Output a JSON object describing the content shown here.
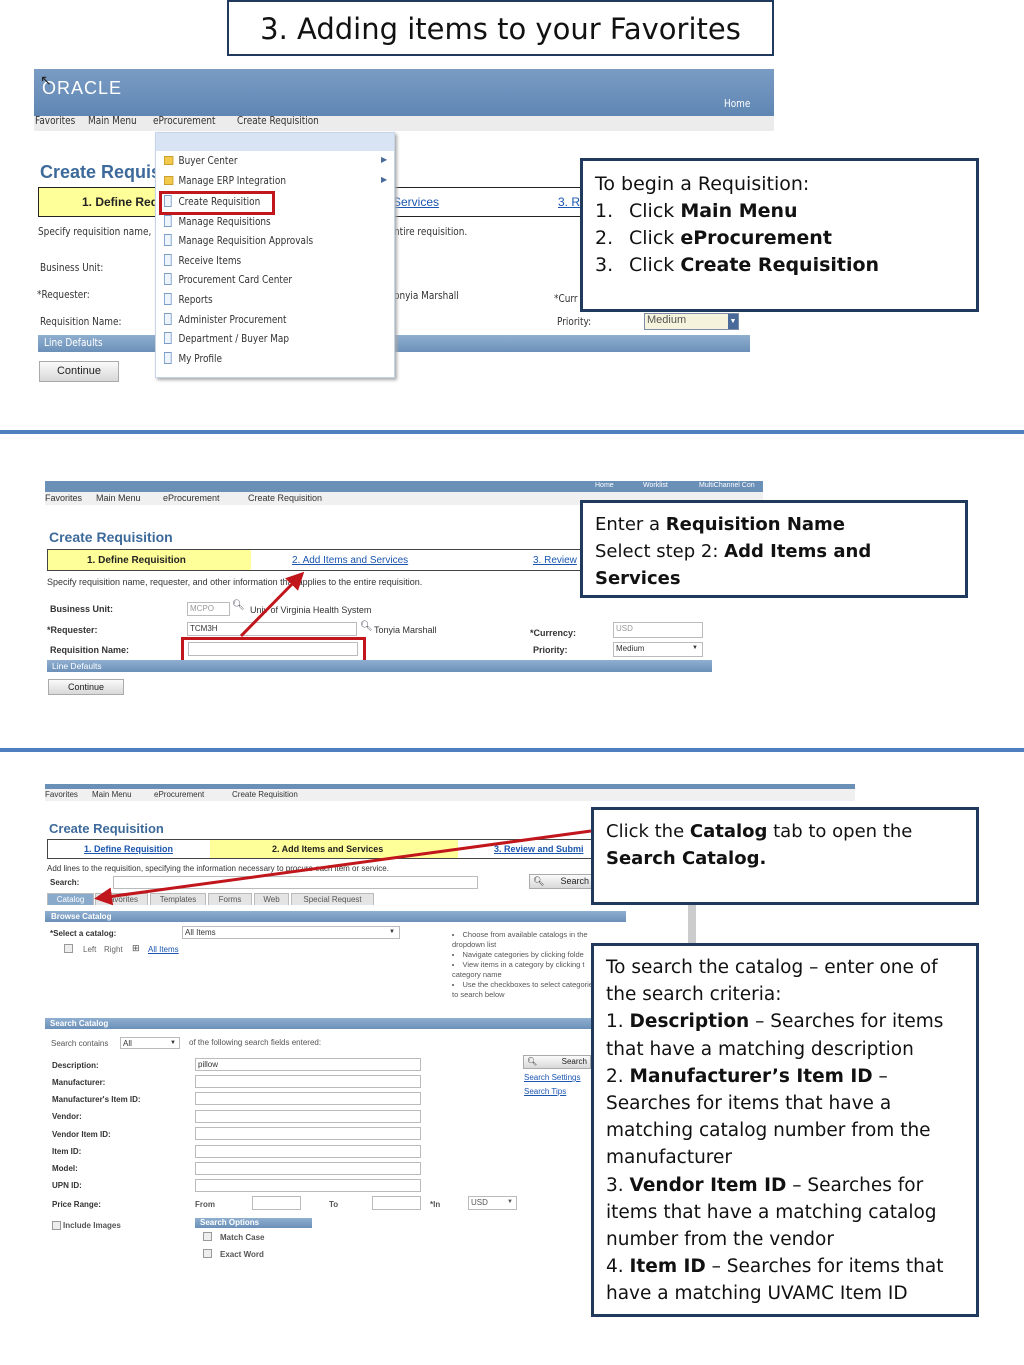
{
  "title": "3. Adding items to your Favorites",
  "colors": {
    "header_blue": "#6b90b8",
    "divider": "#4f7fbf",
    "callout_border": "#1f3a5c",
    "highlight_red": "#c0161c",
    "step_yellow": "#ffff99"
  },
  "panel1": {
    "logo": "ORACLE",
    "home": "Home",
    "breadcrumb": [
      "Favorites",
      "Main Menu",
      "eProcurement",
      "Create Requisition"
    ],
    "page_title": "Create Requisi",
    "step1": "1. Define Req",
    "step2": "Services",
    "step3": "3. R",
    "instruction_left": "Specify requisition name,",
    "instruction_right": "ntire requisition.",
    "labels": {
      "bu": "Business Unit:",
      "req": "*Requester:",
      "name": "Requisition Name:",
      "cur": "*Curr",
      "prio": "Priority:"
    },
    "requester_name": "onyia Marshall",
    "priority": "Medium",
    "line_defaults": "Line Defaults",
    "continue": "Continue",
    "menu": [
      {
        "label": "Buyer Center",
        "icon": "folder-icon",
        "submenu": true
      },
      {
        "label": "Manage ERP Integration",
        "icon": "folder-icon",
        "submenu": true
      },
      {
        "label": "Create Requisition",
        "icon": "document-icon",
        "highlighted": true
      },
      {
        "label": "Manage Requisitions",
        "icon": "document-icon"
      },
      {
        "label": "Manage Requisition Approvals",
        "icon": "document-icon"
      },
      {
        "label": "Receive Items",
        "icon": "document-icon"
      },
      {
        "label": "Procurement Card Center",
        "icon": "document-icon"
      },
      {
        "label": "Reports",
        "icon": "document-icon"
      },
      {
        "label": "Administer Procurement",
        "icon": "document-icon"
      },
      {
        "label": "Department / Buyer Map",
        "icon": "document-icon"
      },
      {
        "label": "My Profile",
        "icon": "document-icon"
      }
    ],
    "callout": {
      "intro": "To begin a Requisition:",
      "steps": [
        {
          "n": "1.",
          "pre": "Click ",
          "bold": "Main Menu"
        },
        {
          "n": "2.",
          "pre": "Click ",
          "bold": "eProcurement"
        },
        {
          "n": "3.",
          "pre": "Click ",
          "bold": "Create Requisition"
        }
      ]
    }
  },
  "panel2": {
    "top_links": [
      "Home",
      "Worklist",
      "MultiChannel Con"
    ],
    "breadcrumb": [
      "Favorites",
      "Main Menu",
      "eProcurement",
      "Create Requisition"
    ],
    "page_title": "Create Requisition",
    "step1": "1. Define Requisition",
    "step2": "2. Add Items and Services",
    "step3": "3. Review",
    "instruction": "Specify requisition name, requester, and other information that applies to the entire requisition.",
    "labels": {
      "bu": "Business Unit:",
      "req": "*Requester:",
      "name": "Requisition Name:",
      "cur": "*Currency:",
      "prio": "Priority:"
    },
    "bu_value": "MCPO",
    "bu_name": "Univ of Virginia Health System",
    "requester": "TCM3H",
    "requester_name": "Tonyia Marshall",
    "currency": "USD",
    "priority": "Medium",
    "requisition_name": "",
    "line_defaults": "Line Defaults",
    "continue": "Continue",
    "callout": {
      "l1_pre": "Enter a ",
      "l1_bold": "Requisition Name",
      "l2_pre": "Select step 2: ",
      "l2_bold": "Add Items and Services"
    }
  },
  "panel3": {
    "breadcrumb": [
      "Favorites",
      "Main Menu",
      "eProcurement",
      "Create Requisition"
    ],
    "page_title": "Create Requisition",
    "step1": "1. Define Requisition",
    "step2": "2. Add Items and Services",
    "step3": "3. Review and Submi",
    "instruction": "Add lines to the requisition, specifying the information necessary to procure each item or service.",
    "search_label": "Search:",
    "search_button": "Search",
    "tabs": [
      "Catalog",
      "Favorites",
      "Templates",
      "Forms",
      "Web",
      "Special Request"
    ],
    "browse_catalog": "Browse Catalog",
    "select_catalog_label": "*Select a catalog:",
    "catalog_value": "All Items",
    "tree": {
      "left": "Left",
      "right": "Right",
      "all": "All Items"
    },
    "tips": [
      "Choose from available catalogs in the dropdown list",
      "Navigate categories by clicking folde",
      "View items in a category by clicking t category name",
      "Use the checkboxes to select categories to search below"
    ],
    "search_catalog": "Search Catalog",
    "search_contains": "Search contains",
    "contains_value": "All",
    "contains_suffix": "of the following search fields entered:",
    "fields": [
      {
        "label": "Description:",
        "value": "pillow"
      },
      {
        "label": "Manufacturer:",
        "value": ""
      },
      {
        "label": "Manufacturer's Item ID:",
        "value": ""
      },
      {
        "label": "Vendor:",
        "value": ""
      },
      {
        "label": "Vendor Item ID:",
        "value": ""
      },
      {
        "label": "Item ID:",
        "value": ""
      },
      {
        "label": "Model:",
        "value": ""
      },
      {
        "label": "UPN ID:",
        "value": ""
      }
    ],
    "price_range": "Price Range:",
    "from": "From",
    "to": "To",
    "in": "*In",
    "currency": "USD",
    "search_settings": "Search Settings",
    "search_tips": "Search Tips",
    "include_images": "Include Images",
    "search_options": "Search Options",
    "match_case": "Match Case",
    "exact_word": "Exact Word",
    "callout1": {
      "pre": "Click the ",
      "bold": "Catalog",
      "post": " tab to open the",
      "bold2": "Search Catalog."
    },
    "callout2": {
      "intro": "To search the catalog – enter one of the search criteria:",
      "items": [
        {
          "n": "1. ",
          "bold": "Description",
          "text": " – Searches for items that have a matching description"
        },
        {
          "n": "2. ",
          "bold": "Manufacturer’s Item ID",
          "text": " – Searches for items that have a matching catalog number from the manufacturer"
        },
        {
          "n": "3. ",
          "bold": "Vendor Item ID",
          "text": " – Searches for items that have a matching catalog number from the vendor"
        },
        {
          "n": "4. ",
          "bold": "Item ID",
          "text": " – Searches for items that have a matching UVAMC Item ID"
        }
      ]
    }
  }
}
